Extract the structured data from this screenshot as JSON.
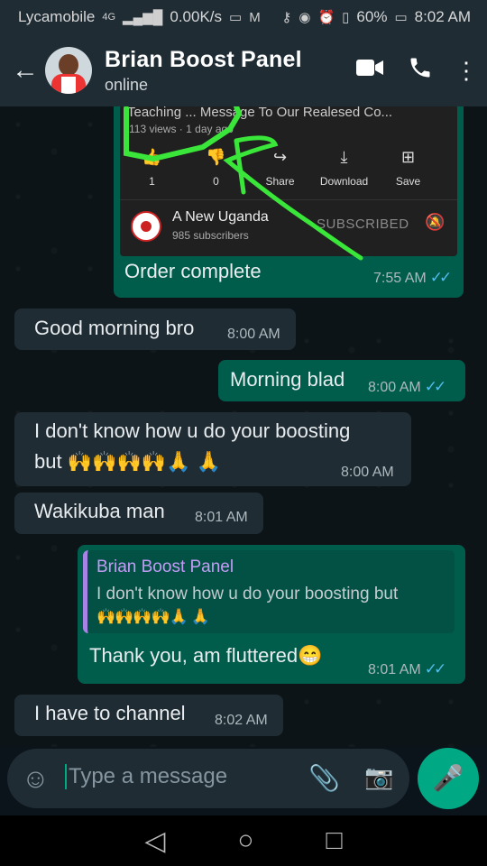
{
  "status_bar": {
    "carrier": "Lycamobile",
    "network": "4G",
    "speed": "0.00K/s",
    "battery": "60%",
    "time": "8:02 AM"
  },
  "header": {
    "contact_name": "Brian Boost Panel",
    "status": "online"
  },
  "youtube_preview": {
    "title_partial": "Teaching ... Message To Our Realesed Co...",
    "views": "113 views · 1 day ago",
    "actions": [
      {
        "icon": "thumbs-up-icon",
        "label": "1"
      },
      {
        "icon": "thumbs-down-icon",
        "label": "0"
      },
      {
        "icon": "share-icon",
        "label": "Share"
      },
      {
        "icon": "download-icon",
        "label": "Download"
      },
      {
        "icon": "save-icon",
        "label": "Save"
      }
    ],
    "channel_name": "A New Uganda",
    "subscribers": "985 subscribers",
    "subscribe_state": "SUBSCRIBED"
  },
  "messages": [
    {
      "dir": "out",
      "text": "Order complete",
      "time": "7:55 AM",
      "read": true
    },
    {
      "dir": "in",
      "text": "Good morning bro",
      "time": "8:00 AM"
    },
    {
      "dir": "out",
      "text": "Morning blad",
      "time": "8:00 AM",
      "read": true
    },
    {
      "dir": "in",
      "text_line1": "I don't know how u do your boosting",
      "text_line2": "but",
      "emojis": "🙌🙌🙌🙌🙏 🙏",
      "time": "8:00 AM"
    },
    {
      "dir": "in",
      "text": "Wakikuba man",
      "time": "8:01 AM"
    },
    {
      "dir": "out",
      "reply_author": "Brian Boost Panel",
      "reply_text": "I don't know how u do your boosting but",
      "reply_emojis": "🙌🙌🙌🙌🙏 🙏",
      "text": "Thank you, am fluttered",
      "emoji": "😁",
      "time": "8:01 AM",
      "read": true
    },
    {
      "dir": "in",
      "text": "I have to channel",
      "time": "8:02 AM"
    }
  ],
  "composer": {
    "placeholder": "Type a message"
  },
  "colors": {
    "incoming": "#1f2c34",
    "outgoing": "#005c4b",
    "accent": "#00a884",
    "read_ticks": "#53bdeb",
    "annotation": "#39e639"
  }
}
